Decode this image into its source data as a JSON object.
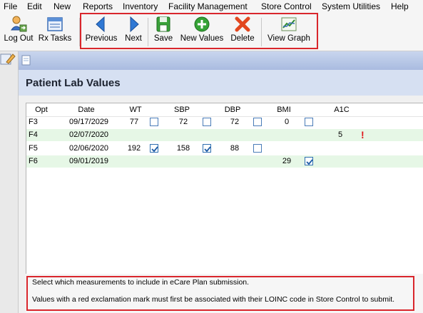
{
  "menu": [
    "File",
    "Edit",
    "New",
    "Reports",
    "Inventory",
    "Facility Management",
    "Store Control",
    "System Utilities",
    "Help"
  ],
  "toolbar": {
    "logout": "Log Out",
    "rx_tasks": "Rx Tasks",
    "previous": "Previous",
    "next": "Next",
    "save": "Save",
    "new_values": "New Values",
    "delete": "Delete",
    "view_graph": "View Graph"
  },
  "page_title": "Patient Lab Values",
  "table": {
    "headers": {
      "opt": "Opt",
      "date": "Date",
      "wt": "WT",
      "sbp": "SBP",
      "dbp": "DBP",
      "bmi": "BMI",
      "a1c": "A1C"
    },
    "rows": [
      {
        "opt": "F3",
        "date": "09/17/2029",
        "wt": "77",
        "wt_checked": false,
        "sbp": "72",
        "sbp_checked": false,
        "dbp": "72",
        "dbp_checked": false,
        "bmi": "0",
        "bmi_checked": false,
        "a1c": "",
        "a1c_flag": false,
        "highlight": false
      },
      {
        "opt": "F4",
        "date": "02/07/2020",
        "wt": "",
        "sbp": "",
        "dbp": "",
        "bmi": "",
        "a1c": "5",
        "a1c_flag": true,
        "highlight": true
      },
      {
        "opt": "F5",
        "date": "02/06/2020",
        "wt": "192",
        "wt_checked": true,
        "sbp": "158",
        "sbp_checked": true,
        "dbp": "88",
        "dbp_checked": false,
        "bmi": "",
        "a1c": "",
        "a1c_flag": false,
        "highlight": false
      },
      {
        "opt": "F6",
        "date": "09/01/2019",
        "wt": "",
        "sbp": "",
        "dbp": "",
        "bmi": "29",
        "bmi_checked": true,
        "a1c": "",
        "a1c_flag": false,
        "highlight": true
      }
    ]
  },
  "notes": {
    "line1": "Select which measurements to include in eCare Plan submission.",
    "line2": "Values with a red exclamation mark must first be associated with their LOINC code in Store Control to submit."
  },
  "colors": {
    "highlight_border": "#d9262c",
    "row_green": "#e6f7e6",
    "header_bg": "#d6e0f2"
  }
}
